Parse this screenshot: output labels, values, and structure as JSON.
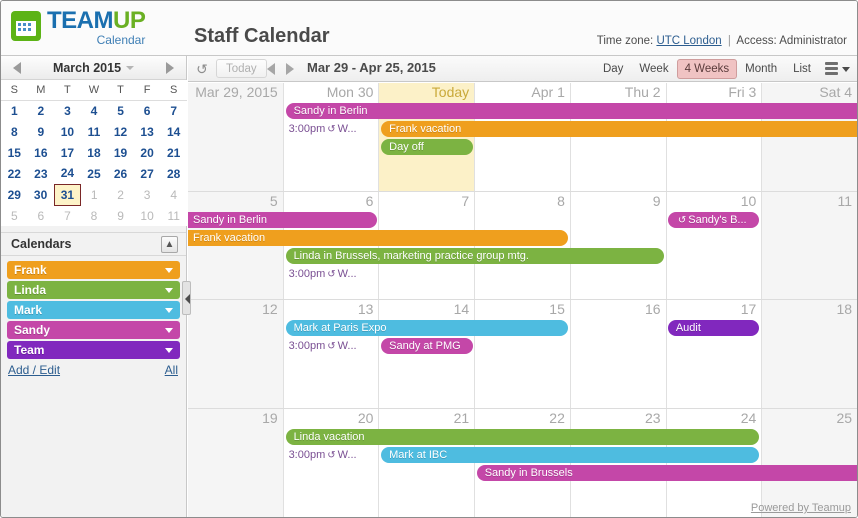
{
  "header": {
    "logo_team": "TEAM",
    "logo_up": "UP",
    "logo_sub": "Calendar",
    "logo_icon": "calendar-grid-icon",
    "page_title": "Staff Calendar",
    "timezone_label": "Time zone:",
    "timezone_value": "UTC London",
    "separator": "|",
    "access_label": "Access: Administrator"
  },
  "sidebar": {
    "mini_calendar": {
      "month_title": "March 2015",
      "prev_icon": "chevron-left-icon",
      "next_icon": "chevron-right-icon",
      "dropdown_icon": "chevron-down-icon",
      "weekday_headers": [
        "S",
        "M",
        "T",
        "W",
        "T",
        "F",
        "S"
      ],
      "weeks": [
        [
          {
            "d": "1",
            "t": "cur"
          },
          {
            "d": "2",
            "t": "cur"
          },
          {
            "d": "3",
            "t": "cur"
          },
          {
            "d": "4",
            "t": "cur"
          },
          {
            "d": "5",
            "t": "cur"
          },
          {
            "d": "6",
            "t": "cur"
          },
          {
            "d": "7",
            "t": "cur"
          }
        ],
        [
          {
            "d": "8",
            "t": "cur"
          },
          {
            "d": "9",
            "t": "cur"
          },
          {
            "d": "10",
            "t": "cur"
          },
          {
            "d": "11",
            "t": "cur"
          },
          {
            "d": "12",
            "t": "cur"
          },
          {
            "d": "13",
            "t": "cur"
          },
          {
            "d": "14",
            "t": "cur"
          }
        ],
        [
          {
            "d": "15",
            "t": "cur"
          },
          {
            "d": "16",
            "t": "cur"
          },
          {
            "d": "17",
            "t": "cur"
          },
          {
            "d": "18",
            "t": "cur"
          },
          {
            "d": "19",
            "t": "cur"
          },
          {
            "d": "20",
            "t": "cur"
          },
          {
            "d": "21",
            "t": "cur"
          }
        ],
        [
          {
            "d": "22",
            "t": "cur"
          },
          {
            "d": "23",
            "t": "cur"
          },
          {
            "d": "24",
            "t": "cur"
          },
          {
            "d": "25",
            "t": "cur"
          },
          {
            "d": "26",
            "t": "cur"
          },
          {
            "d": "27",
            "t": "cur"
          },
          {
            "d": "28",
            "t": "cur"
          }
        ],
        [
          {
            "d": "29",
            "t": "cur"
          },
          {
            "d": "30",
            "t": "cur"
          },
          {
            "d": "31",
            "t": "today"
          },
          {
            "d": "1",
            "t": "other"
          },
          {
            "d": "2",
            "t": "other"
          },
          {
            "d": "3",
            "t": "other"
          },
          {
            "d": "4",
            "t": "other"
          }
        ],
        [
          {
            "d": "5",
            "t": "other"
          },
          {
            "d": "6",
            "t": "other"
          },
          {
            "d": "7",
            "t": "other"
          },
          {
            "d": "8",
            "t": "other"
          },
          {
            "d": "9",
            "t": "other"
          },
          {
            "d": "10",
            "t": "other"
          },
          {
            "d": "11",
            "t": "other"
          }
        ]
      ]
    },
    "calendars_section": {
      "title": "Calendars",
      "collapse_icon": "collapse-up-icon",
      "items": [
        {
          "label": "Frank",
          "color": "#ef9f1e"
        },
        {
          "label": "Linda",
          "color": "#7cb342"
        },
        {
          "label": "Mark",
          "color": "#4ebce0"
        },
        {
          "label": "Sandy",
          "color": "#c447a8"
        },
        {
          "label": "Team",
          "color": "#8128be"
        }
      ],
      "add_edit_label": "Add / Edit",
      "all_label": "All"
    },
    "splitter_icon": "collapse-left-handle"
  },
  "toolbar": {
    "refresh_icon": "refresh-icon",
    "today_label": "Today",
    "prev_icon": "chevron-left-icon",
    "next_icon": "chevron-right-icon",
    "range_label": "Mar 29 - Apr 25, 2015",
    "views": [
      {
        "label": "Day",
        "active": false
      },
      {
        "label": "Week",
        "active": false
      },
      {
        "label": "4 Weeks",
        "active": true
      },
      {
        "label": "Month",
        "active": false
      },
      {
        "label": "List",
        "active": false
      }
    ],
    "menu_icon": "hamburger-menu-icon",
    "menu_caret_icon": "chevron-down-icon"
  },
  "grid": {
    "powered_by": "Powered by Teamup",
    "recur_icon": "↺",
    "weeks": [
      {
        "days": [
          {
            "label": "Mar 29, 2015",
            "weekend": true,
            "today": false,
            "wide": true
          },
          {
            "label": "Mon 30",
            "weekend": false,
            "today": false,
            "wide": false
          },
          {
            "label": "Today",
            "weekend": false,
            "today": true,
            "wide": false
          },
          {
            "label": "Apr 1",
            "weekend": false,
            "today": false,
            "wide": false
          },
          {
            "label": "Thu 2",
            "weekend": false,
            "today": false,
            "wide": false
          },
          {
            "label": "Fri 3",
            "weekend": false,
            "today": false,
            "wide": false
          },
          {
            "label": "Sat 4",
            "weekend": true,
            "today": false,
            "wide": false
          }
        ],
        "events": [
          {
            "title": "Sandy in Berlin",
            "color": "#c447a8",
            "start": 1,
            "span": 6,
            "lane": 0,
            "open_right": true,
            "recurring": false
          },
          {
            "title": "Frank vacation",
            "color": "#ef9f1e",
            "start": 2,
            "span": 5,
            "lane": 1,
            "open_right": true,
            "recurring": false
          },
          {
            "title": "Day off",
            "color": "#7cb342",
            "start": 2,
            "span": 1,
            "lane": 2,
            "open_right": false,
            "recurring": false
          }
        ],
        "time_slots": [
          {
            "time": "3:00pm",
            "suffix": "W...",
            "col": 1,
            "lane": 1
          }
        ]
      },
      {
        "days": [
          {
            "label": "5",
            "weekend": true,
            "today": false,
            "wide": false
          },
          {
            "label": "6",
            "weekend": false,
            "today": false,
            "wide": false
          },
          {
            "label": "7",
            "weekend": false,
            "today": false,
            "wide": false
          },
          {
            "label": "8",
            "weekend": false,
            "today": false,
            "wide": false
          },
          {
            "label": "9",
            "weekend": false,
            "today": false,
            "wide": false
          },
          {
            "label": "10",
            "weekend": false,
            "today": false,
            "wide": false
          },
          {
            "label": "11",
            "weekend": true,
            "today": false,
            "wide": false
          }
        ],
        "events": [
          {
            "title": "Sandy in Berlin",
            "color": "#c447a8",
            "start": 0,
            "span": 2,
            "lane": 0,
            "open_left": true,
            "recurring": false
          },
          {
            "title": "Frank vacation",
            "color": "#ef9f1e",
            "start": 0,
            "span": 4,
            "lane": 1,
            "open_left": true,
            "recurring": false
          },
          {
            "title": "Sandy's B...",
            "color": "#c447a8",
            "start": 5,
            "span": 1,
            "lane": 0,
            "recurring": true
          },
          {
            "title": "Linda in Brussels, marketing practice group mtg.",
            "color": "#7cb342",
            "start": 1,
            "span": 4,
            "lane": 2,
            "recurring": false
          }
        ],
        "time_slots": [
          {
            "time": "3:00pm",
            "suffix": "W...",
            "col": 1,
            "lane": 3
          }
        ]
      },
      {
        "days": [
          {
            "label": "12",
            "weekend": true,
            "today": false,
            "wide": false
          },
          {
            "label": "13",
            "weekend": false,
            "today": false,
            "wide": false
          },
          {
            "label": "14",
            "weekend": false,
            "today": false,
            "wide": false
          },
          {
            "label": "15",
            "weekend": false,
            "today": false,
            "wide": false
          },
          {
            "label": "16",
            "weekend": false,
            "today": false,
            "wide": false
          },
          {
            "label": "17",
            "weekend": false,
            "today": false,
            "wide": false
          },
          {
            "label": "18",
            "weekend": true,
            "today": false,
            "wide": false
          }
        ],
        "events": [
          {
            "title": "Mark at Paris Expo",
            "color": "#4ebce0",
            "start": 1,
            "span": 3,
            "lane": 0,
            "recurring": false
          },
          {
            "title": "Audit",
            "color": "#8128be",
            "start": 5,
            "span": 1,
            "lane": 0,
            "recurring": false
          },
          {
            "title": "Sandy at PMG",
            "color": "#c447a8",
            "start": 2,
            "span": 1,
            "lane": 1,
            "recurring": false
          }
        ],
        "time_slots": [
          {
            "time": "3:00pm",
            "suffix": "W...",
            "col": 1,
            "lane": 1
          }
        ]
      },
      {
        "days": [
          {
            "label": "19",
            "weekend": true,
            "today": false,
            "wide": false
          },
          {
            "label": "20",
            "weekend": false,
            "today": false,
            "wide": false
          },
          {
            "label": "21",
            "weekend": false,
            "today": false,
            "wide": false
          },
          {
            "label": "22",
            "weekend": false,
            "today": false,
            "wide": false
          },
          {
            "label": "23",
            "weekend": false,
            "today": false,
            "wide": false
          },
          {
            "label": "24",
            "weekend": false,
            "today": false,
            "wide": false
          },
          {
            "label": "25",
            "weekend": true,
            "today": false,
            "wide": false
          }
        ],
        "events": [
          {
            "title": "Linda vacation",
            "color": "#7cb342",
            "start": 1,
            "span": 5,
            "lane": 0,
            "recurring": false
          },
          {
            "title": "Mark at IBC",
            "color": "#4ebce0",
            "start": 2,
            "span": 4,
            "lane": 1,
            "recurring": false
          },
          {
            "title": "Sandy in Brussels",
            "color": "#c447a8",
            "start": 3,
            "span": 4,
            "lane": 2,
            "open_right": true,
            "recurring": false
          }
        ],
        "time_slots": [
          {
            "time": "3:00pm",
            "suffix": "W...",
            "col": 1,
            "lane": 1
          }
        ]
      }
    ]
  }
}
